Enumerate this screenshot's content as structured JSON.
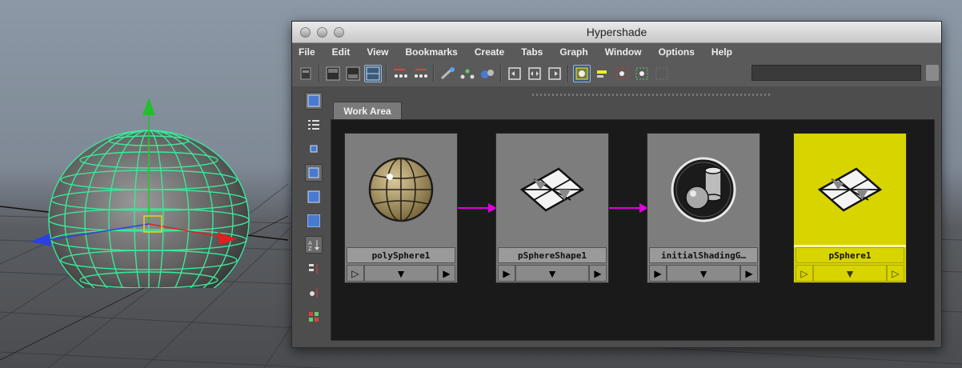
{
  "window": {
    "title": "Hypershade"
  },
  "menu": [
    "File",
    "Edit",
    "View",
    "Bookmarks",
    "Create",
    "Tabs",
    "Graph",
    "Window",
    "Options",
    "Help"
  ],
  "tabs": {
    "work_area": "Work Area"
  },
  "nodes": [
    {
      "label": "polySphere1",
      "icon": "poly-sphere-icon",
      "selected": false
    },
    {
      "label": "pSphereShape1",
      "icon": "mesh-shape-icon",
      "selected": false
    },
    {
      "label": "initialShadingG…",
      "icon": "shading-group-icon",
      "selected": false
    },
    {
      "label": "pSphere1",
      "icon": "mesh-transform-icon",
      "selected": true
    }
  ],
  "ports": {
    "input": "▷",
    "expand": "▼",
    "output": "▶"
  },
  "colors": {
    "selected_node": "#d8d400",
    "connection": "#e000e0",
    "wireframe": "#3be89a",
    "axis_x": "#e02020",
    "axis_y": "#22c02a",
    "axis_z": "#2a40e0"
  }
}
